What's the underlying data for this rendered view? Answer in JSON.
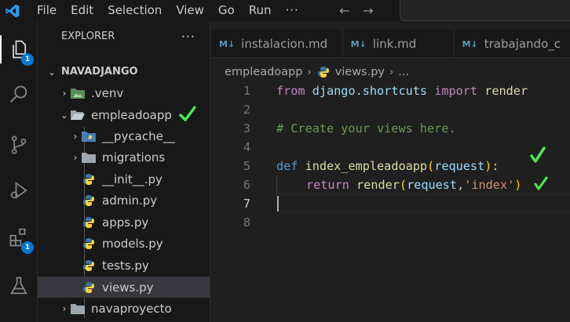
{
  "menu": {
    "items": [
      "File",
      "Edit",
      "Selection",
      "View",
      "Go",
      "Run"
    ],
    "more": "···"
  },
  "activity_bar": {
    "explorer_badge": "1",
    "extensions_badge": "1"
  },
  "sidebar": {
    "title": "EXPLORER",
    "actions": "···",
    "project": "NAVADJANGO",
    "tree": [
      {
        "label": ".venv",
        "icon": "folder-venv-icon",
        "expanded": false
      },
      {
        "label": "empleadoapp",
        "icon": "folder-open-icon",
        "expanded": true
      },
      {
        "label": "__pycache__",
        "icon": "folder-python-icon",
        "expanded": false
      },
      {
        "label": "migrations",
        "icon": "folder-icon",
        "expanded": false
      },
      {
        "label": "__init__.py",
        "icon": "python-icon"
      },
      {
        "label": "admin.py",
        "icon": "python-icon"
      },
      {
        "label": "apps.py",
        "icon": "python-icon"
      },
      {
        "label": "models.py",
        "icon": "python-icon"
      },
      {
        "label": "tests.py",
        "icon": "python-icon"
      },
      {
        "label": "views.py",
        "icon": "python-icon",
        "selected": true
      },
      {
        "label": "navaproyecto",
        "icon": "folder-icon",
        "expanded": false
      }
    ]
  },
  "tabs": [
    {
      "label": "instalacion.md",
      "icon": "markdown-icon",
      "icon_text": "M↓"
    },
    {
      "label": "link.md",
      "icon": "markdown-icon",
      "icon_text": "M↓"
    },
    {
      "label": "trabajando_c",
      "icon": "markdown-icon",
      "icon_text": "M↓"
    }
  ],
  "breadcrumbs": {
    "folder": "empleadoapp",
    "file": "views.py",
    "more": "..."
  },
  "code": {
    "line_numbers": [
      "1",
      "2",
      "3",
      "4",
      "5",
      "6",
      "7",
      "8"
    ],
    "current_line": "7",
    "l1": {
      "kw": "from",
      "module": "django.shortcuts",
      "kw2": "import",
      "name": "render"
    },
    "l3": {
      "comment": "# Create your views here."
    },
    "l5": {
      "kw": "def",
      "fn": "index_empleadoapp",
      "open": "(",
      "param": "request",
      "close": "):"
    },
    "l6": {
      "kw": "return",
      "fn": "render",
      "open": "(",
      "arg": "request",
      "comma": ",",
      "str": "'index'",
      "close": ")"
    }
  },
  "colors": {
    "accent": "#0078d4",
    "check_mark": "#4ee44e"
  }
}
